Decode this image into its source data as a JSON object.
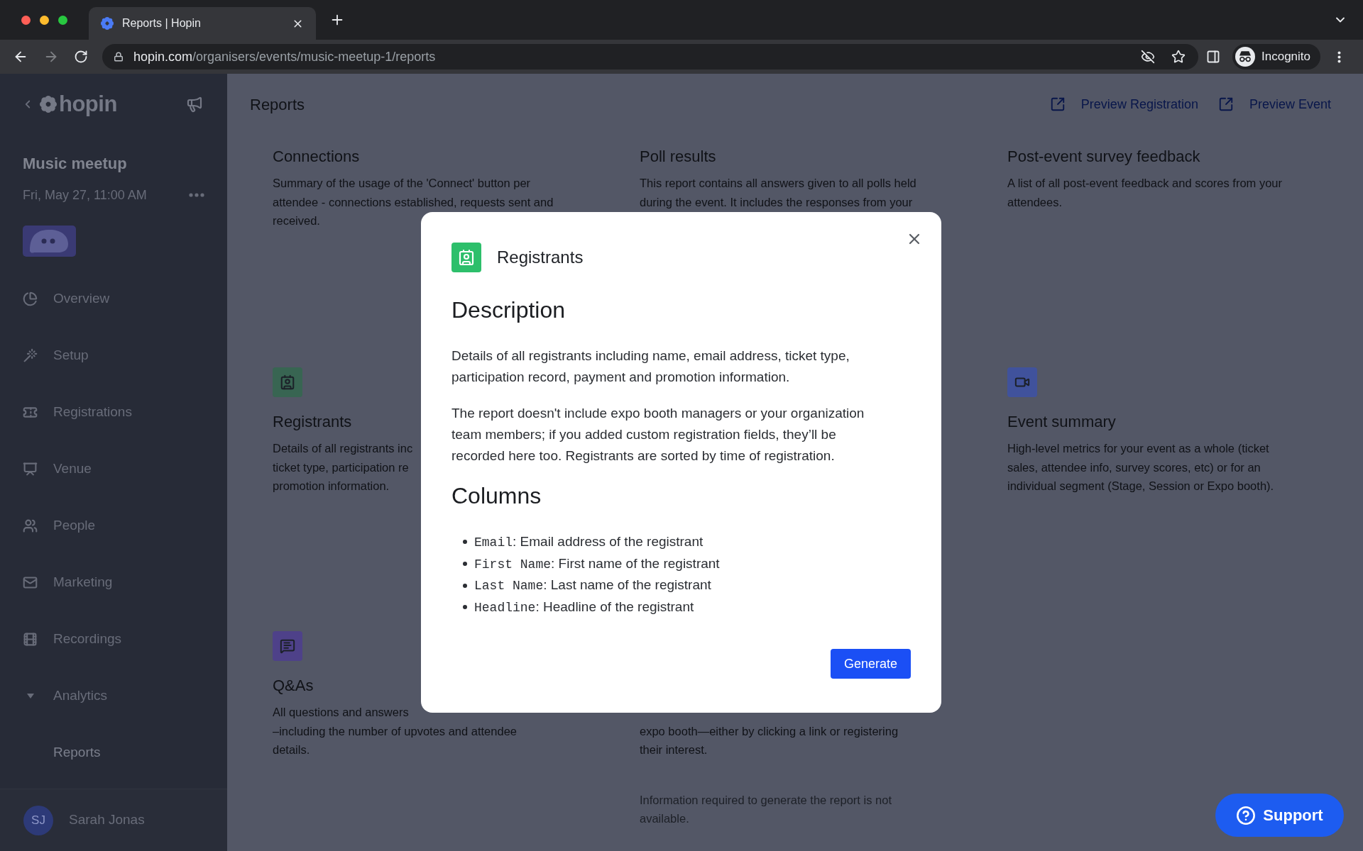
{
  "browser": {
    "tab_title": "Reports | Hopin",
    "url_host": "hopin.com",
    "url_path": "/organisers/events/music-meetup-1/reports",
    "forward_disabled": true,
    "profile": "Incognito"
  },
  "sidebar": {
    "logo": "hopin",
    "event_name": "Music meetup",
    "event_date": "Fri, May 27, 11:00 AM",
    "nav": [
      {
        "label": "Overview",
        "selected": false
      },
      {
        "label": "Setup",
        "selected": false
      },
      {
        "label": "Registrations",
        "selected": false
      },
      {
        "label": "Venue",
        "selected": false
      },
      {
        "label": "People",
        "selected": false
      },
      {
        "label": "Marketing",
        "selected": false
      },
      {
        "label": "Recordings",
        "selected": false
      },
      {
        "label": "Analytics",
        "selected": false,
        "expanded": true,
        "children": [
          {
            "label": "Reports",
            "selected": true
          }
        ]
      }
    ],
    "user": {
      "initials": "SJ",
      "name": "Sarah Jonas"
    }
  },
  "page": {
    "title": "Reports",
    "links": [
      "Preview Registration",
      "Preview Event"
    ],
    "report_rows": [
      {
        "left": {
          "title": "Connections",
          "description_lines": [
            "Summary of the usage of the 'Connect' button per",
            "attendee - connections established, requests sent and",
            "received."
          ]
        },
        "middle": {
          "title": "Poll results",
          "description_lines": [
            "This report contains all answers given to all polls held",
            "during the event. It includes the responses from your"
          ]
        },
        "right": {
          "title": "Post-event survey feedback",
          "description_lines": [
            "A list of all post-event feedback and scores from your",
            "attendees."
          ]
        }
      },
      {
        "left": {
          "color": "#386552",
          "title": "Registrants",
          "description_lines": [
            "Details of all registrants inc",
            "ticket type, participation re",
            "promotion information."
          ]
        },
        "right": {
          "color": "#40529c",
          "title": "Event summary",
          "description_lines": [
            "High-level metrics for your event as a whole (ticket",
            "sales, attendee info, survey scores, etc) or for an",
            "individual segment (Stage, Session or Expo booth)."
          ]
        }
      },
      {
        "left": {
          "color": "#4e4189",
          "title": "Q&As",
          "description_lines": [
            "All questions and answers",
            "–including the number of upvotes and attendee",
            "details."
          ]
        },
        "middle": {
          "description_lines": [
            "expo booth—either by clicking a link or registering",
            "their interest."
          ],
          "note_lines": [
            "Information required to generate the report is not",
            "available."
          ]
        }
      }
    ]
  },
  "modal": {
    "title": "Registrants",
    "description_heading": "Description",
    "paragraphs": [
      "Details of all registrants including name, email address, ticket type, participation record, payment and promotion information.",
      "The report doesn't include expo booth managers or your organization team members; if you added custom registration fields, they’ll be recorded here too. Registrants are sorted by time of registration."
    ],
    "columns_heading": "Columns",
    "columns": [
      {
        "term": "Email",
        "rest": ": Email address of the registrant"
      },
      {
        "term": "First Name",
        "rest": ": First name of the registrant"
      },
      {
        "term": "Last Name",
        "rest": ": Last name of the registrant"
      },
      {
        "term": "Headline",
        "rest": ": Headline of the registrant"
      }
    ],
    "button": "Generate"
  },
  "support_button": {
    "label": "Support"
  }
}
